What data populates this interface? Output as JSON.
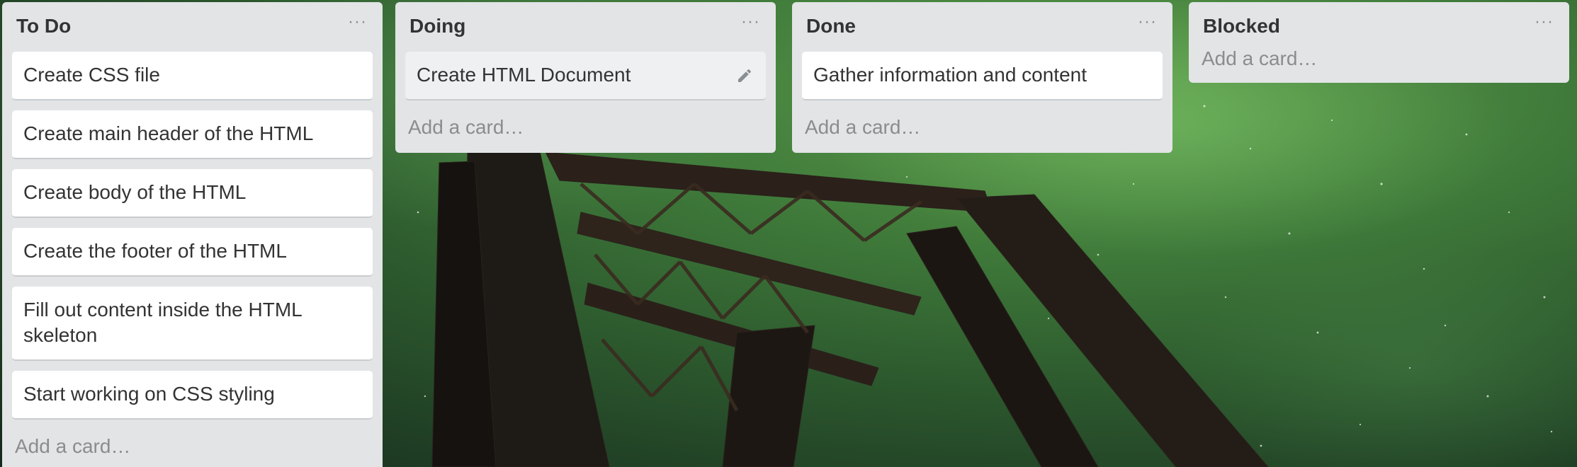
{
  "lists": [
    {
      "title": "To Do",
      "menu_label": "···",
      "cards": [
        "Create CSS file",
        "Create main header of the HTML",
        "Create body of the HTML",
        "Create the footer of the HTML",
        "Fill out content inside the HTML skeleton",
        "Start working on CSS styling"
      ],
      "add_card_label": "Add a card…"
    },
    {
      "title": "Doing",
      "menu_label": "···",
      "cards": [
        "Create HTML Document"
      ],
      "add_card_label": "Add a card…"
    },
    {
      "title": "Done",
      "menu_label": "···",
      "cards": [
        "Gather information and content"
      ],
      "add_card_label": "Add a card…"
    },
    {
      "title": "Blocked",
      "menu_label": "···",
      "cards": [],
      "add_card_label": "Add a card…"
    }
  ],
  "icons": {
    "list_menu": "ellipsis-icon",
    "card_edit": "pencil-icon"
  },
  "colors": {
    "list_background": "#e2e4e6",
    "card_background": "#ffffff",
    "card_hover_background": "#eef0f1",
    "title_text": "#333333",
    "add_card_text": "#8c8c8c"
  }
}
